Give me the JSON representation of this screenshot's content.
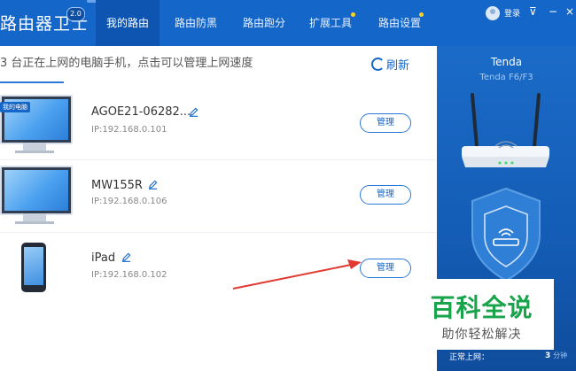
{
  "header": {
    "app_title": "路由器卫士",
    "version": "2.0",
    "nav": [
      {
        "label": "我的路由",
        "active": true
      },
      {
        "label": "路由防黑",
        "active": false
      },
      {
        "label": "路由跑分",
        "active": false
      },
      {
        "label": "扩展工具",
        "active": false,
        "notify": true
      },
      {
        "label": "路由设置",
        "active": false,
        "notify": true
      }
    ],
    "login_label": "登录"
  },
  "toolbar": {
    "info_text": "3 台正在上网的电脑手机，点击可以管理上网速度",
    "refresh_label": "刷新"
  },
  "devices": [
    {
      "type": "computer",
      "tag": "我的电脑",
      "name": "AGOE21-06282...",
      "ip": "IP:192.168.0.101",
      "manage_label": "管理"
    },
    {
      "type": "computer",
      "name": "MW155R",
      "ip": "IP:192.168.0.106",
      "manage_label": "管理"
    },
    {
      "type": "phone",
      "name": "iPad",
      "ip": "IP:192.168.0.102",
      "manage_label": "管理"
    }
  ],
  "router_panel": {
    "brand": "Tenda",
    "model": "Tenda F6/F3",
    "online_label": "正常上网：",
    "online_count": "3",
    "online_unit": "分钟"
  },
  "watermark": {
    "title": "百科全说",
    "subtitle": "助你轻松解决"
  },
  "colors": {
    "brand_blue": "#1466c9",
    "watermark_green": "#19a34a",
    "arrow_red": "#e03a33"
  }
}
